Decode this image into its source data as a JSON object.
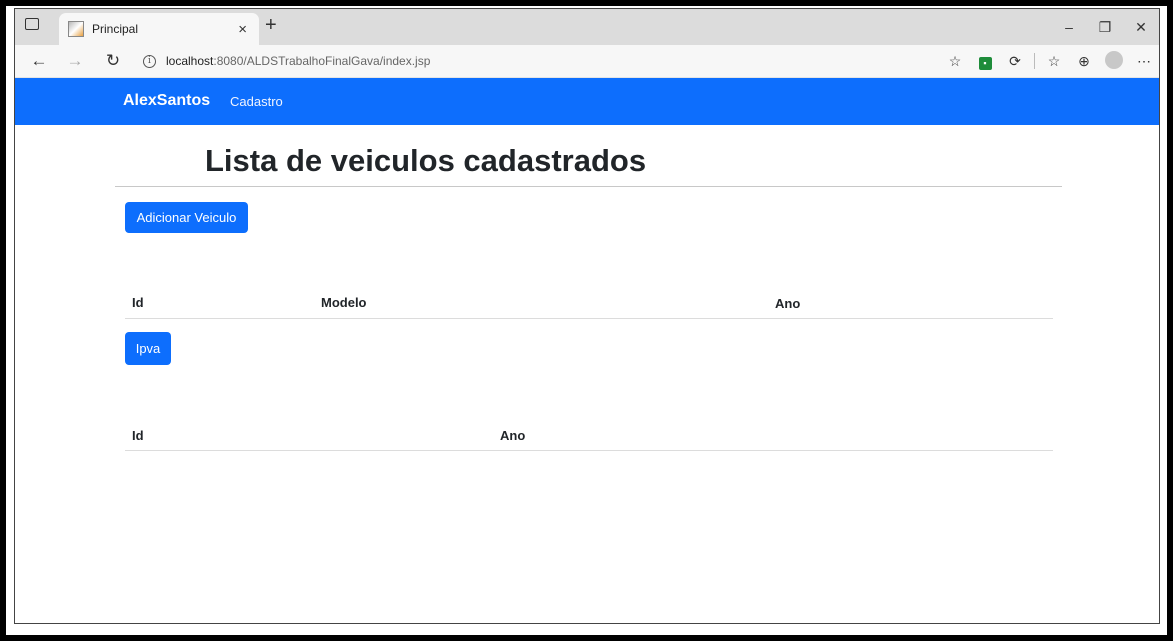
{
  "browser": {
    "tab_title": "Principal",
    "tab_close": "×",
    "new_tab": "+",
    "url_host": "localhost",
    "url_rest": ":8080/ALDSTrabalhoFinalGava/index.jsp",
    "window_controls": [
      "–",
      "❐",
      "✕"
    ],
    "icons": [
      "sidebar-icon",
      "favicon",
      "back-icon",
      "forward-icon",
      "refresh-icon",
      "info-icon",
      "favorite-icon",
      "extension-icon",
      "puzzle-icon",
      "favorites-list-icon",
      "collections-icon",
      "profile-icon",
      "more-icon"
    ]
  },
  "navbar": {
    "brand": "AlexSantos",
    "link": "Cadastro",
    "color": "#0d6efd"
  },
  "main": {
    "title": "Lista de veiculos cadastrados",
    "add_button": "Adicionar Veiculo",
    "table1": {
      "headers": [
        "Id",
        "Modelo",
        "Ano"
      ],
      "rows": []
    },
    "ipva_button": "Ipva",
    "table2": {
      "headers": [
        "Id",
        "Ano"
      ],
      "rows": []
    }
  }
}
